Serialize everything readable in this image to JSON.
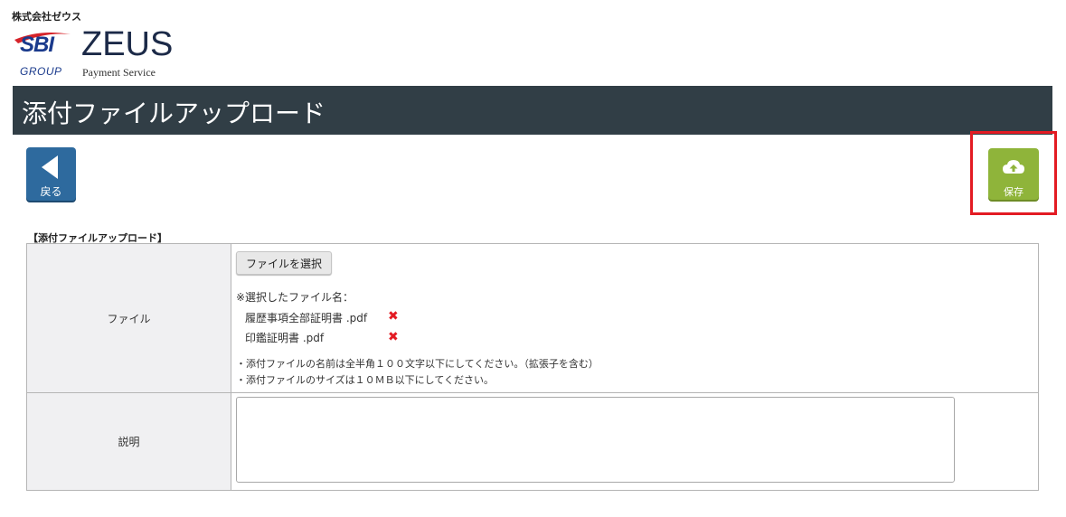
{
  "header": {
    "company": "株式会社ゼウス",
    "logo": {
      "sbi": "SBI",
      "group": "GROUP",
      "brand": "ZEUS",
      "tagline": "Payment Service"
    },
    "page_title": "添付ファイルアップロード"
  },
  "toolbar": {
    "back_label": "戻る",
    "back_icon": "arrow-left-icon",
    "save_label": "保存",
    "save_icon": "cloud-upload-icon"
  },
  "form": {
    "section_title": "【添付ファイルアップロード】",
    "file_row": {
      "label": "ファイル",
      "choose_button": "ファイルを選択",
      "selected_label": "※選択したファイル名：",
      "files": [
        "履歴事項全部証明書 .pdf",
        "印鑑証明書 .pdf"
      ],
      "notes": [
        "・添付ファイルの名前は全半角１００文字以下にしてください。（拡張子を含む）",
        "・添付ファイルのサイズは１０ＭＢ以下にしてください。"
      ]
    },
    "description_row": {
      "label": "説明",
      "value": ""
    }
  },
  "colors": {
    "title_bar": "#313e46",
    "back_button": "#2e6a9e",
    "save_button": "#8fb43a",
    "highlight": "#e31b23",
    "delete": "#e31b23"
  }
}
